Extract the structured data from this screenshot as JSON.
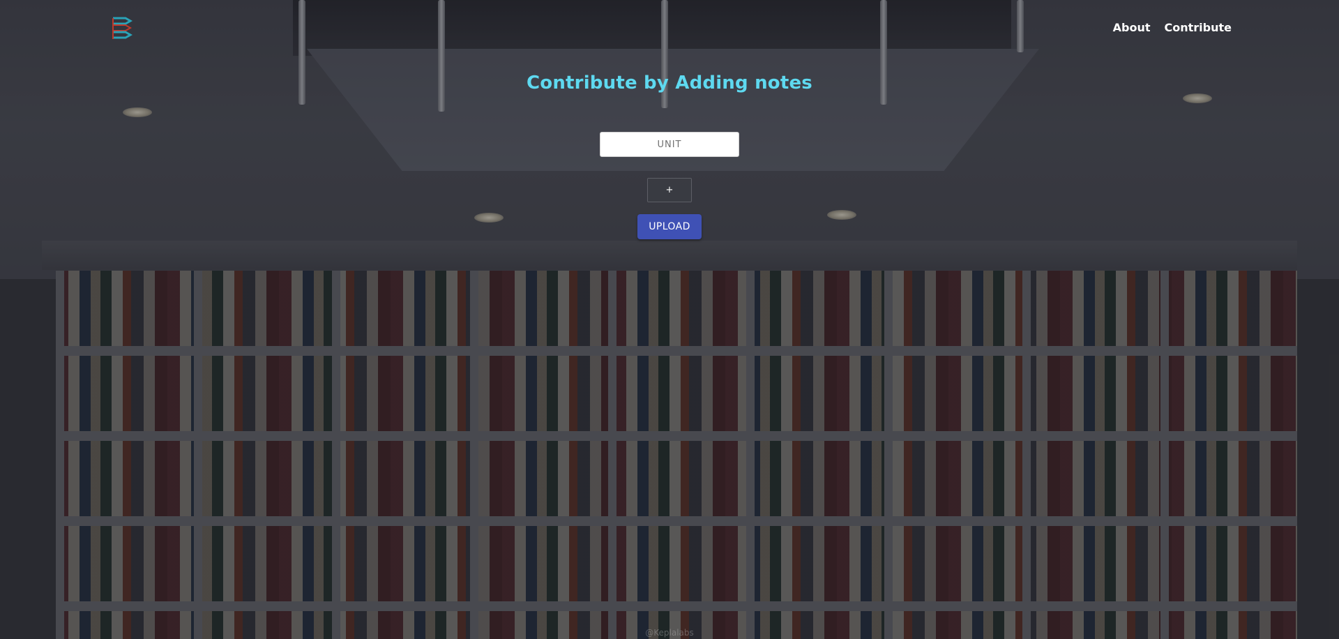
{
  "brand": {
    "logo_icon": "book-stack-icon",
    "colors": {
      "primary": "#2aa3b8",
      "secondary": "#c0392b"
    }
  },
  "nav": {
    "items": [
      {
        "label": "About"
      },
      {
        "label": "Contribute"
      }
    ]
  },
  "main": {
    "title": "Contribute by Adding notes",
    "unit_input": {
      "placeholder": "UNIT",
      "value": ""
    },
    "add_label": "+",
    "upload_label": "UPLOAD"
  },
  "footer": {
    "watermark": "@Keplalabs"
  },
  "colors": {
    "title": "#5ed9f0",
    "upload_button": "#3f51b5",
    "nav_text": "#ffffff"
  }
}
